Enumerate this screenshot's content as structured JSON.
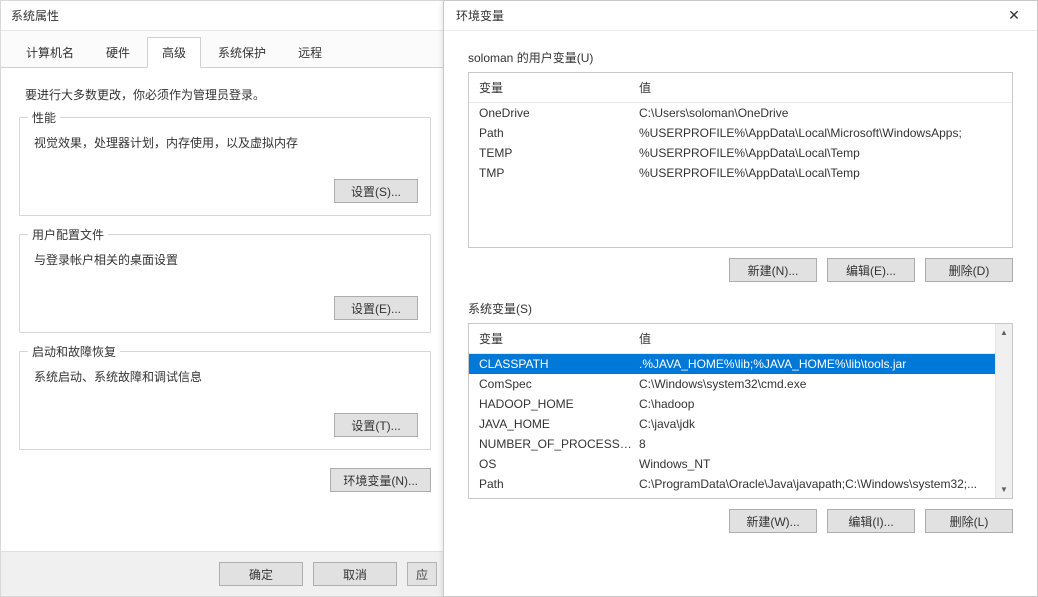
{
  "sys_props": {
    "title": "系统属性",
    "tabs": [
      "计算机名",
      "硬件",
      "高级",
      "系统保护",
      "远程"
    ],
    "active_tab_index": 2,
    "hint": "要进行大多数更改，你必须作为管理员登录。",
    "perf": {
      "legend": "性能",
      "desc": "视觉效果，处理器计划，内存使用，以及虚拟内存",
      "btn": "设置(S)..."
    },
    "profiles": {
      "legend": "用户配置文件",
      "desc": "与登录帐户相关的桌面设置",
      "btn": "设置(E)..."
    },
    "startup": {
      "legend": "启动和故障恢复",
      "desc": "系统启动、系统故障和调试信息",
      "btn": "设置(T)..."
    },
    "env_btn": "环境变量(N)...",
    "footer": {
      "ok": "确定",
      "cancel": "取消",
      "apply": "应"
    }
  },
  "env": {
    "title": "环境变量",
    "close": "✕",
    "user_section_label": "soloman 的用户变量(U)",
    "system_section_label": "系统变量(S)",
    "col_name": "变量",
    "col_value": "值",
    "user_vars": [
      {
        "name": "OneDrive",
        "value": "C:\\Users\\soloman\\OneDrive"
      },
      {
        "name": "Path",
        "value": "%USERPROFILE%\\AppData\\Local\\Microsoft\\WindowsApps;"
      },
      {
        "name": "TEMP",
        "value": "%USERPROFILE%\\AppData\\Local\\Temp"
      },
      {
        "name": "TMP",
        "value": "%USERPROFILE%\\AppData\\Local\\Temp"
      }
    ],
    "system_vars": [
      {
        "name": "CLASSPATH",
        "value": ".%JAVA_HOME%\\lib;%JAVA_HOME%\\lib\\tools.jar",
        "selected": true
      },
      {
        "name": "ComSpec",
        "value": "C:\\Windows\\system32\\cmd.exe"
      },
      {
        "name": "HADOOP_HOME",
        "value": "C:\\hadoop"
      },
      {
        "name": "JAVA_HOME",
        "value": "C:\\java\\jdk"
      },
      {
        "name": "NUMBER_OF_PROCESSORS",
        "value": "8"
      },
      {
        "name": "OS",
        "value": "Windows_NT"
      },
      {
        "name": "Path",
        "value": "C:\\ProgramData\\Oracle\\Java\\javapath;C:\\Windows\\system32;..."
      }
    ],
    "user_buttons": {
      "new": "新建(N)...",
      "edit": "编辑(E)...",
      "del": "删除(D)"
    },
    "sys_buttons": {
      "new": "新建(W)...",
      "edit": "编辑(I)...",
      "del": "删除(L)"
    }
  }
}
